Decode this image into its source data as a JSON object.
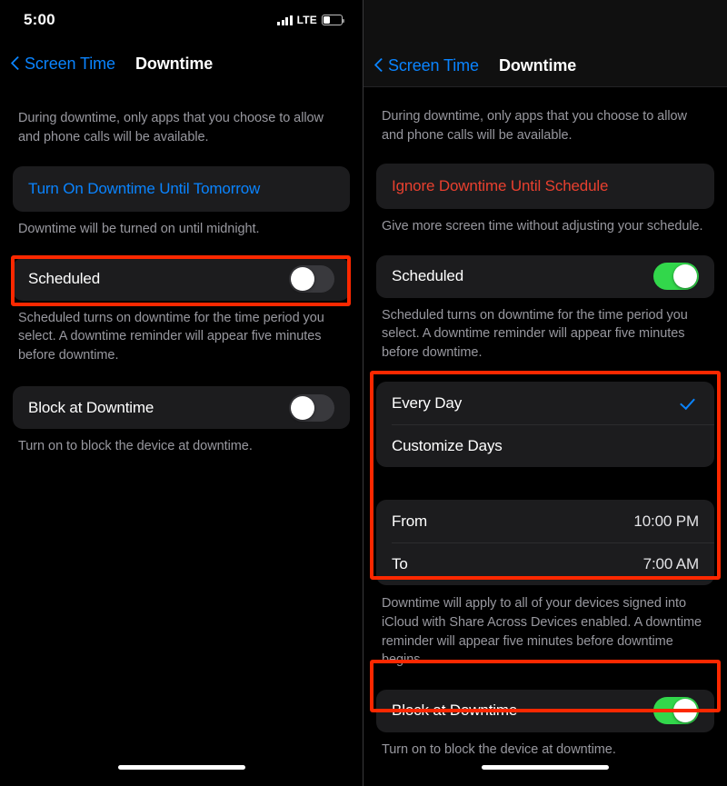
{
  "status_bar": {
    "time": "5:00",
    "carrier": "LTE",
    "signal_icon": "signal-bars-icon",
    "battery_icon": "battery-icon",
    "battery_level_percent": 36
  },
  "colors": {
    "accent_blue": "#0a84ff",
    "destructive_red": "#e8402f",
    "toggle_on_green": "#32d74b",
    "toggle_off_gray": "#39393d",
    "card_background": "#1c1c1e",
    "highlight_red": "#fc2800",
    "secondary_text": "#98989f"
  },
  "left_panel": {
    "nav": {
      "back_label": "Screen Time",
      "back_icon": "chevron-left-icon",
      "title": "Downtime"
    },
    "intro_note": "During downtime, only apps that you choose to allow and phone calls will be available.",
    "action_button": {
      "label": "Turn On Downtime Until Tomorrow",
      "style": "blue"
    },
    "action_note": "Downtime will be turned on until midnight.",
    "scheduled_row": {
      "label": "Scheduled",
      "toggle_state": "off",
      "highlighted": true
    },
    "scheduled_note": "Scheduled turns on downtime for the time period you select. A downtime reminder will appear five minutes before downtime.",
    "block_row": {
      "label": "Block at Downtime",
      "toggle_state": "off",
      "highlighted": false
    },
    "block_note": "Turn on to block the device at downtime."
  },
  "right_panel": {
    "nav": {
      "back_label": "Screen Time",
      "back_icon": "chevron-left-icon",
      "title": "Downtime"
    },
    "intro_note": "During downtime, only apps that you choose to allow and phone calls will be available.",
    "action_button": {
      "label": "Ignore Downtime Until Schedule",
      "style": "red"
    },
    "action_note": "Give more screen time without adjusting your schedule.",
    "scheduled_row": {
      "label": "Scheduled",
      "toggle_state": "on",
      "highlighted": false
    },
    "scheduled_note": "Scheduled turns on downtime for the time period you select. A downtime reminder will appear five minutes before downtime.",
    "days_options": [
      {
        "label": "Every Day",
        "selected": true,
        "check_icon": "checkmark-icon"
      },
      {
        "label": "Customize Days",
        "selected": false
      }
    ],
    "time_rows": [
      {
        "label": "From",
        "value": "10:00 PM"
      },
      {
        "label": "To",
        "value": "7:00 AM"
      }
    ],
    "schedule_note": "Downtime will apply to all of your devices signed into iCloud with Share Across Devices enabled. A downtime reminder will appear five minutes before downtime begins.",
    "block_row": {
      "label": "Block at Downtime",
      "toggle_state": "on",
      "highlighted": true
    },
    "block_note": "Turn on to block the device at downtime."
  }
}
